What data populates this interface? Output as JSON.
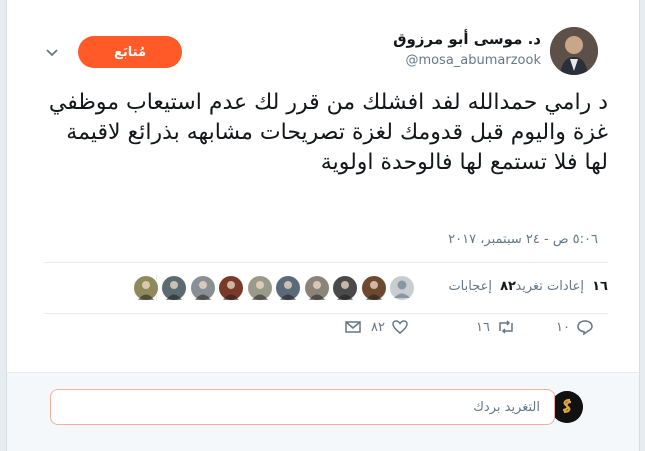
{
  "author": {
    "display_name": "د. موسى أبو مرزوق",
    "handle": "@mosa_abumarzook"
  },
  "follow_button_label": "مُتابَع",
  "tweet_text": "د رامي حمدالله لفد افشلك من قرر لك عدم استيعاب موظفي غزة واليوم قبل قدومك لغزة تصريحات مشابهه بذرائع لاقيمة لها فلا تستمع لها فالوحدة اولوية",
  "timestamp": "٥:٠٦ ص - ٢٤ سبتمبر، ٢٠١٧",
  "stats": {
    "retweets_count": "١٦",
    "retweets_label": "إعادات تغريد",
    "likes_count": "٨٢",
    "likes_label": "إعجابات"
  },
  "liker_avatars": [
    {
      "color": "#c8cdd2",
      "icon": "default-avatar"
    },
    {
      "color": "#6d4a2f"
    },
    {
      "color": "#4a4a4a"
    },
    {
      "color": "#8c8478"
    },
    {
      "color": "#5a6a7a"
    },
    {
      "color": "#9a9a8a"
    },
    {
      "color": "#7a3a2a"
    },
    {
      "color": "#8a8f96"
    },
    {
      "color": "#5b6b72"
    },
    {
      "color": "#8f8a5a"
    }
  ],
  "actions": {
    "reply_count": "١٠",
    "retweet_count": "١٦",
    "like_count": "٨٢"
  },
  "reply_box": {
    "placeholder": "التغريد بردك"
  },
  "colors": {
    "accent": "#ff5a27",
    "muted": "#657786"
  }
}
